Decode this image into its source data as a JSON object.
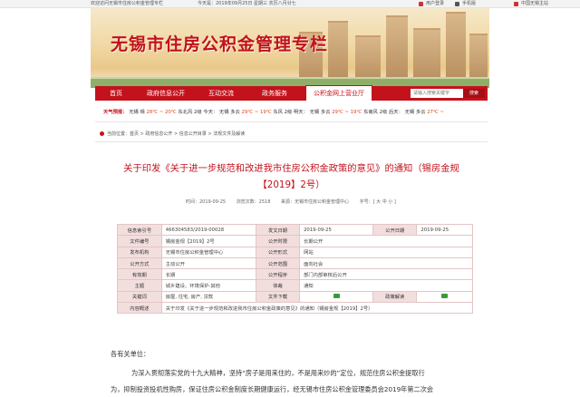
{
  "topbar": {
    "welcome": "欢迎访问无锡市住房公积金管理专栏",
    "date": "今天是：2019年09月25日  星期三  农历八月廿七",
    "user_center": "用户登录",
    "mobile": "手机版",
    "china_wuxi": "中国无锡主站"
  },
  "banner": {
    "title": "无锡市住房公积金管理专栏"
  },
  "nav": {
    "items": [
      "首页",
      "政府信息公开",
      "互动交流",
      "政务服务",
      "公积金网上营业厅"
    ],
    "search_placeholder": "请输入搜索关键字",
    "search_button": "搜索"
  },
  "weather": {
    "label": "天气预报：",
    "entries": [
      {
        "city": "无锡",
        "cond": "晴",
        "temp": "28℃ ~ 20℃"
      },
      {
        "city": "东北风",
        "cond": "2级 今天：",
        "temp": ""
      },
      {
        "city": "无锡",
        "cond": "多云",
        "temp": "29℃ ~ 19℃"
      },
      {
        "city": "东风",
        "cond": "2级 明天：",
        "temp": ""
      },
      {
        "city": "无锡",
        "cond": "多云",
        "temp": "29℃ ~ 19℃"
      },
      {
        "city": "东南风",
        "cond": "2级 后天：",
        "temp": ""
      },
      {
        "city": "无锡",
        "cond": "多云",
        "temp": "27℃ ~"
      }
    ]
  },
  "breadcrumb": {
    "prefix": "当前位置：",
    "items": [
      "首页",
      "政府信息公开",
      "信息公开目录",
      "法规文件及解读"
    ],
    "sep": " > "
  },
  "document": {
    "title_line1": "关于印发《关于进一步规范和改进我市住房公积金政策的意见》的通知（锡房金规",
    "title_line2": "【2019】2号）",
    "time": "时间：2019-09-25",
    "clicks": "浏览次数：2518",
    "source": "来源：无锡市住房公积金管理中心",
    "font_size": "字号：[ 大 中 小 ]"
  },
  "info_table": {
    "rows": [
      {
        "k1": "信息索引号",
        "v1": "466304583/2019-00028",
        "k2": "发文日期",
        "v2": "2019-09-25",
        "k3": "公开日期",
        "v3": "2019-09-25"
      },
      {
        "k1": "文件编号",
        "v1": "锡房金规【2019】2号",
        "k2": "公开时限",
        "v2": "长期公开"
      },
      {
        "k1": "发布机构",
        "v1": "无锡市住房公积金管理中心",
        "k2": "公开形式",
        "v2": "网站"
      },
      {
        "k1": "公开方式",
        "v1": "主动公开",
        "k2": "公开范围",
        "v2": "面向社会"
      },
      {
        "k1": "有效期",
        "v1": "长期",
        "k2": "公开程序",
        "v2": "部门内部审核后公开"
      },
      {
        "k1": "主题",
        "v1": "城乡建设、环境保护-其他",
        "k2": "体裁",
        "v2": "通知"
      },
      {
        "k1": "关键词",
        "v1": "房屋, 住宅, 房产, 贷款",
        "k2": "文件下载",
        "v2": "",
        "k3": "政策解读",
        "v3": ""
      }
    ],
    "content_label": "内容概述",
    "content_value": "关于印发《关于进一步规范和改进我市住房公积金政策的意见》的通知（锡房金规【2019】2号）"
  },
  "body": {
    "greeting": "各有关单位：",
    "para1": "为深入贯彻落实党的十九大精神，坚持“房子是用来住的，不是用来炒的”定位，规范住房公积金提取行",
    "para2": "为，抑制投资投机性购房，保证住房公积金制度长期健康运行，经无锡市住房公积金管理委员会2019年第二次会"
  },
  "colors": {
    "accent": "#c4121c",
    "table_key_bg": "#f3dede",
    "download_icon": "#3c9a3c"
  }
}
